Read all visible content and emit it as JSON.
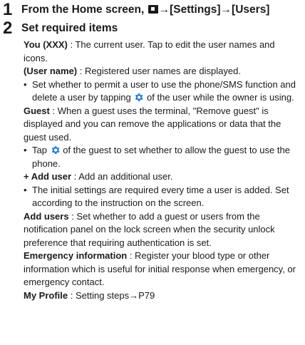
{
  "steps": [
    {
      "number": "1",
      "title_prefix": "From the Home screen,",
      "title_suffix": "→[Settings]→[Users]",
      "icon": "home-key-icon"
    },
    {
      "number": "2",
      "title": "Set required items"
    }
  ],
  "items": {
    "you": {
      "term": "You (XXX)",
      "sep": " : ",
      "text": "The current user. Tap to edit the user names and icons."
    },
    "user_name": {
      "term": "(User name)",
      "sep": " : ",
      "text": "Registered user names are displayed.",
      "bullet_before": "Set whether to permit a user to use the phone/SMS function and delete a user by tapping",
      "bullet_after": "of the user while the owner is using."
    },
    "guest": {
      "term": "Guest",
      "sep": " : ",
      "text": "When a guest uses the terminal, \"Remove guest\" is displayed and you can remove the applications or data that the guest used.",
      "bullet_before": "Tap",
      "bullet_after": "of the guest to set whether to allow the guest to use the phone."
    },
    "add_user": {
      "term": "+ Add user",
      "sep": " : ",
      "text": "Add an additional user.",
      "bullet": "The initial settings are required every time a user is added. Set according to the instruction on the screen."
    },
    "add_users": {
      "term": "Add users",
      "sep": " : ",
      "text": "Set whether to add a guest or users from the notification panel on the lock screen when the security unlock preference that requiring authentication is set."
    },
    "emergency": {
      "term": "Emergency information",
      "sep": " : ",
      "text": "Register your blood type or other information which is useful for initial response when emergency, or emergency contact."
    },
    "profile": {
      "term": "My Profile",
      "sep": " : ",
      "text": "Setting steps→P79"
    }
  },
  "colors": {
    "gear": "#2a7fd4",
    "text": "#1a1a1a"
  }
}
